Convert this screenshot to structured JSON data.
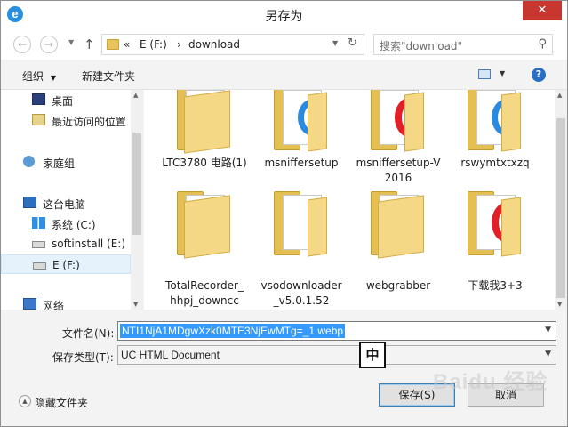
{
  "window": {
    "title": "另存为",
    "app_icon": "ie-icon",
    "close_label": "✕"
  },
  "nav": {
    "back_glyph": "←",
    "forward_glyph": "→",
    "up_glyph": "↑",
    "address": {
      "chevrons": "«",
      "drive": "E (F:)",
      "separator": "›",
      "folder": "download"
    },
    "refresh_glyph": "↻",
    "search_placeholder": "搜索\"download\"",
    "search_glyph": "⚲"
  },
  "toolbar": {
    "organize": "组织",
    "organize_arrow": "▼",
    "new_folder": "新建文件夹",
    "help": "?"
  },
  "sidebar": {
    "items": [
      {
        "label": "桌面",
        "icon": "desktop-icon"
      },
      {
        "label": "最近访问的位置",
        "icon": "recent-places-icon"
      },
      {
        "label": "家庭组",
        "icon": "homegroup-icon"
      },
      {
        "label": "这台电脑",
        "icon": "this-pc-icon"
      },
      {
        "label": "系统 (C:)",
        "icon": "system-drive-icon"
      },
      {
        "label": "softinstall (E:)",
        "icon": "drive-icon"
      },
      {
        "label": "E (F:)",
        "icon": "drive-icon",
        "selected": true
      },
      {
        "label": "网络",
        "icon": "network-icon"
      }
    ]
  },
  "files": [
    {
      "line1": "LTC3780 电路(1)",
      "line2": "",
      "badge": "none"
    },
    {
      "line1": "msniffersetup",
      "line2": "",
      "badge": "ie"
    },
    {
      "line1": "msniffersetup-V",
      "line2": "2016",
      "badge": "opera"
    },
    {
      "line1": "rswymtxtxzq",
      "line2": "",
      "badge": "ie"
    },
    {
      "line1": "TotalRecorder_",
      "line2": "hhpj_downcc",
      "badge": "none"
    },
    {
      "line1": "vsodownloader",
      "line2": "_v5.0.1.52",
      "badge": "small"
    },
    {
      "line1": "webgrabber",
      "line2": "",
      "badge": "none"
    },
    {
      "line1": "下载我3+3",
      "line2": "",
      "badge": "opera"
    }
  ],
  "form": {
    "filename_label": "文件名(N):",
    "filename_value": "NTI1NjA1MDgwXzk0MTE3NjEwMTg=_1.webp",
    "filetype_label": "保存类型(T):",
    "filetype_value": "UC HTML Document",
    "dropdown_glyph": "▼",
    "ime_indicator": "中"
  },
  "footer": {
    "hide_folders": "隐藏文件夹",
    "save": "保存(S)",
    "cancel": "取消",
    "watermark": "Baidu 经验"
  },
  "colors": {
    "close": "#c7372f",
    "selection": "#3399ff",
    "folder": "#e4bf52",
    "nav_selected": "#e5f1fb"
  }
}
